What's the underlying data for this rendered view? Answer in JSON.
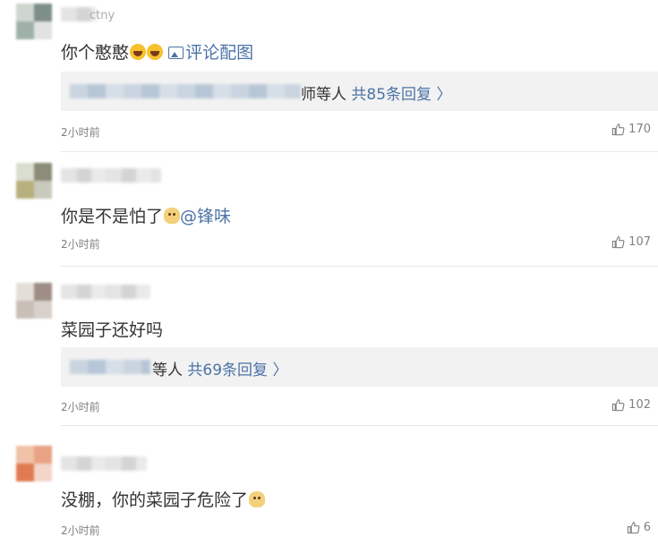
{
  "comments": [
    {
      "username_partial": "ctny",
      "text": "你个憨憨",
      "picture_link": "评论配图",
      "reply_names_suffix": "师等人",
      "reply_link": "共85条回复 〉",
      "time": "2小时前",
      "likes": "170",
      "avatar_colors": [
        "#cfd6cf",
        "#9fb0a8",
        "#7e8e88",
        "#e2e2e2"
      ]
    },
    {
      "text": "你是不是怕了",
      "mention": "@锋味",
      "time": "2小时前",
      "likes": "107",
      "avatar_colors": [
        "#d9dfd0",
        "#b9b07f",
        "#8c8c7a",
        "#c9c9bc"
      ]
    },
    {
      "text": "菜园子还好吗",
      "reply_names_suffix": "等人",
      "reply_link": "共69条回复 〉",
      "time": "2小时前",
      "likes": "102",
      "avatar_colors": [
        "#e4ded8",
        "#9e8e86",
        "#c8bfb6",
        "#d8d0ca"
      ]
    },
    {
      "text": "没棚，你的菜园子危险了",
      "time": "2小时前",
      "likes": "6",
      "avatar_colors": [
        "#f0c2a8",
        "#e07a50",
        "#f3d6c8",
        "#e9a283"
      ]
    }
  ],
  "icons": {
    "like": "thumbs-up-icon",
    "picture": "image-icon",
    "emoji_laugh": "laughing-emoji-icon",
    "emoji_doge": "doge-emoji-icon"
  },
  "colors": {
    "link": "#4b73a6",
    "text": "#333333",
    "meta": "#808080",
    "reply_bg": "#f2f2f2"
  }
}
